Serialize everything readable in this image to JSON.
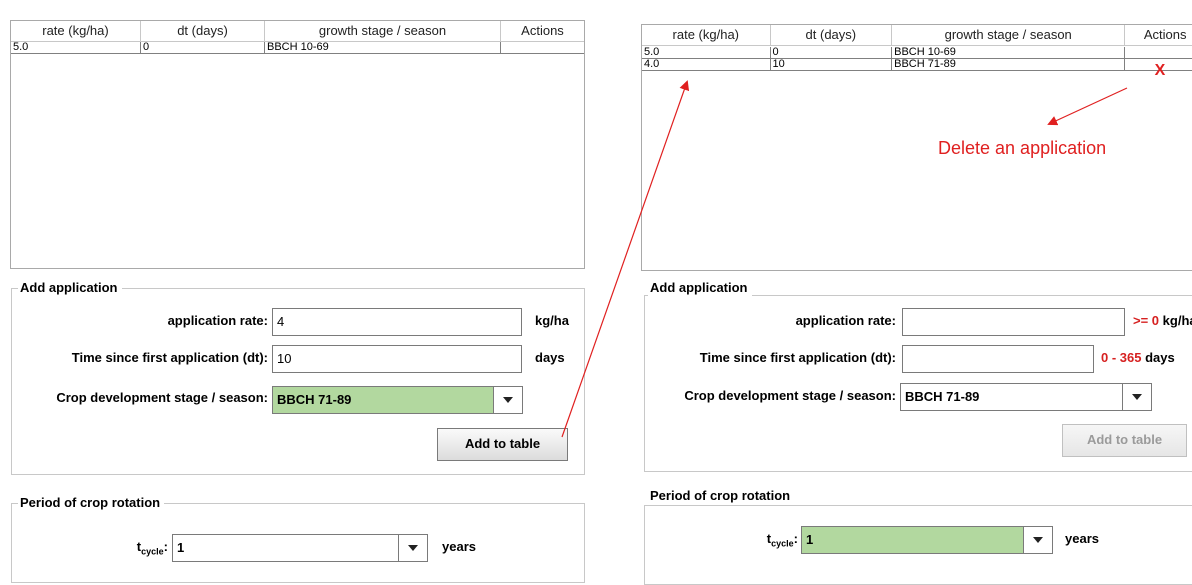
{
  "columns": [
    "rate (kg/ha)",
    "dt (days)",
    "growth stage / season",
    "Actions"
  ],
  "left": {
    "rows": [
      {
        "rate": "5.0",
        "dt": "0",
        "stage": "BBCH 10-69",
        "action": ""
      }
    ],
    "add_application": {
      "legend": "Add application",
      "rate_label": "application rate:",
      "rate_value": "4",
      "rate_unit": "kg/ha",
      "dt_label": "Time since first application (dt):",
      "dt_value": "10",
      "dt_unit": "days",
      "stage_label": "Crop development stage / season:",
      "stage_value": "BBCH 71-89",
      "add_button": "Add to table"
    },
    "rotation": {
      "legend": "Period of crop rotation",
      "label_main": "t",
      "label_sub": "cycle",
      "label_suffix": ":",
      "value": "1",
      "unit": "years"
    }
  },
  "right": {
    "rows": [
      {
        "rate": "5.0",
        "dt": "0",
        "stage": "BBCH 10-69",
        "action": ""
      },
      {
        "rate": "4.0",
        "dt": "10",
        "stage": "BBCH 71-89",
        "action": "X"
      }
    ],
    "annotation": "Delete an application",
    "add_application": {
      "legend": "Add application",
      "rate_label": "application rate:",
      "rate_value": "",
      "rate_hint": ">= 0",
      "rate_unit": "kg/ha",
      "dt_label": "Time since first application (dt):",
      "dt_value": "",
      "dt_hint": "0 - 365",
      "dt_unit": "days",
      "stage_label": "Crop development stage / season:",
      "stage_value": "BBCH 71-89",
      "add_button": "Add to table"
    },
    "rotation": {
      "legend": "Period of crop rotation",
      "label_main": "t",
      "label_sub": "cycle",
      "label_suffix": ":",
      "value": "1",
      "unit": "years"
    }
  },
  "colors": {
    "combo_highlight": "#b2d89f",
    "annotation_red": "#e02020",
    "hint_red": "#d62020"
  }
}
